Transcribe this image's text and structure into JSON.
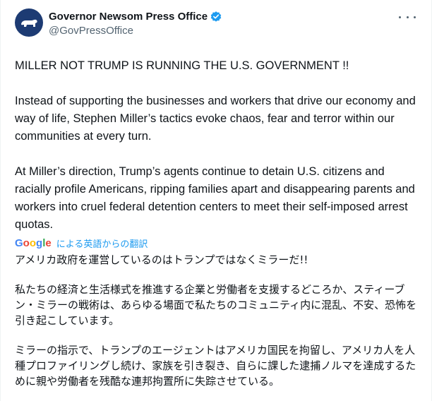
{
  "author": {
    "display_name": "Governor Newsom Press Office",
    "handle": "@GovPressOffice",
    "avatar_icon": "california-bear-icon",
    "verified_icon": "verified-badge-icon",
    "verified_color": "#1d9bf0",
    "more_icon": "more-options-icon"
  },
  "tweet": {
    "paragraphs": [
      "MILLER NOT TRUMP IS RUNNING THE U.S. GOVERNMENT !!",
      "Instead of supporting the businesses and workers that drive our economy and way of life, Stephen Miller’s tactics evoke chaos, fear and terror within our communities at every turn.",
      "At Miller’s direction, Trump’s agents continue to detain U.S. citizens and racially profile Americans, ripping families apart and disappearing parents and workers into cruel federal detention centers to meet their self-imposed arrest quotas."
    ]
  },
  "translation": {
    "provider_logo": "Google",
    "label": "による英語からの翻訳",
    "paragraphs": [
      "アメリカ政府を運営しているのはトランプではなくミラーだ!!",
      "私たちの経済と生活様式を推進する企業と労働者を支援するどころか、スティーブン・ミラーの戦術は、あらゆる場面で私たちのコミュニティ内に混乱、不安、恐怖を引き起こしています。",
      "ミラーの指示で、トランプのエージェントはアメリカ国民を拘留し、アメリカ人を人種プロファイリングし続け、家族を引き裂き、自らに課した逮捕ノルマを達成するために親や労働者を残酷な連邦拘置所に失踪させている。"
    ]
  }
}
